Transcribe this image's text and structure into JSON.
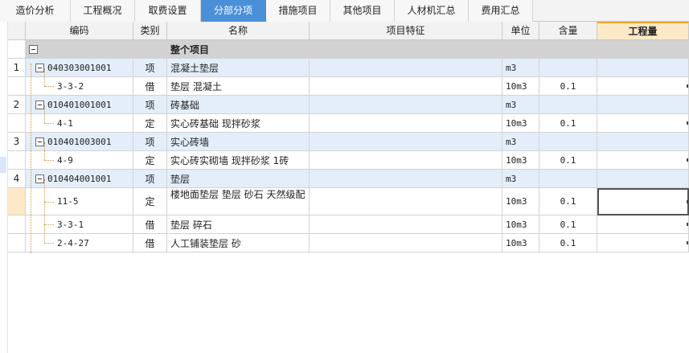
{
  "tabs": [
    {
      "label": "造价分析",
      "active": false
    },
    {
      "label": "工程概况",
      "active": false
    },
    {
      "label": "取费设置",
      "active": false
    },
    {
      "label": "分部分项",
      "active": true
    },
    {
      "label": "措施项目",
      "active": false
    },
    {
      "label": "其他项目",
      "active": false
    },
    {
      "label": "人材机汇总",
      "active": false
    },
    {
      "label": "费用汇总",
      "active": false
    }
  ],
  "columns": {
    "code": "编码",
    "type": "类别",
    "name": "名称",
    "feature": "项目特征",
    "unit": "单位",
    "content": "含量",
    "quantity": "工程量"
  },
  "root_row": {
    "name": "整个项目"
  },
  "rows": [
    {
      "num": "1",
      "code": "040303001001",
      "type": "项",
      "name": "混凝土垫层",
      "unit": "m3",
      "content": ""
    },
    {
      "num": "",
      "code": "3-3-2",
      "type": "借",
      "name": "垫层 混凝土",
      "unit": "10m3",
      "content": "0.1"
    },
    {
      "num": "2",
      "code": "010401001001",
      "type": "项",
      "name": "砖基础",
      "unit": "m3",
      "content": ""
    },
    {
      "num": "",
      "code": "4-1",
      "type": "定",
      "name": "实心砖基础 现拌砂浆",
      "unit": "10m3",
      "content": "0.1"
    },
    {
      "num": "3",
      "code": "010401003001",
      "type": "项",
      "name": "实心砖墙",
      "unit": "m3",
      "content": ""
    },
    {
      "num": "",
      "code": "4-9",
      "type": "定",
      "name": "实心砖实砌墙 现拌砂浆 1砖",
      "unit": "10m3",
      "content": "0.1"
    },
    {
      "num": "4",
      "code": "010404001001",
      "type": "项",
      "name": "垫层",
      "unit": "m3",
      "content": ""
    },
    {
      "num": "",
      "code": "11-5",
      "type": "定",
      "name": "楼地面垫层 垫层 砂石 天然级配",
      "unit": "10m3",
      "content": "0.1"
    },
    {
      "num": "",
      "code": "3-3-1",
      "type": "借",
      "name": "垫层 碎石",
      "unit": "10m3",
      "content": "0.1"
    },
    {
      "num": "",
      "code": "2-4-27",
      "type": "借",
      "name": "人工铺装垫层 砂",
      "unit": "10m3",
      "content": "0.1"
    }
  ]
}
